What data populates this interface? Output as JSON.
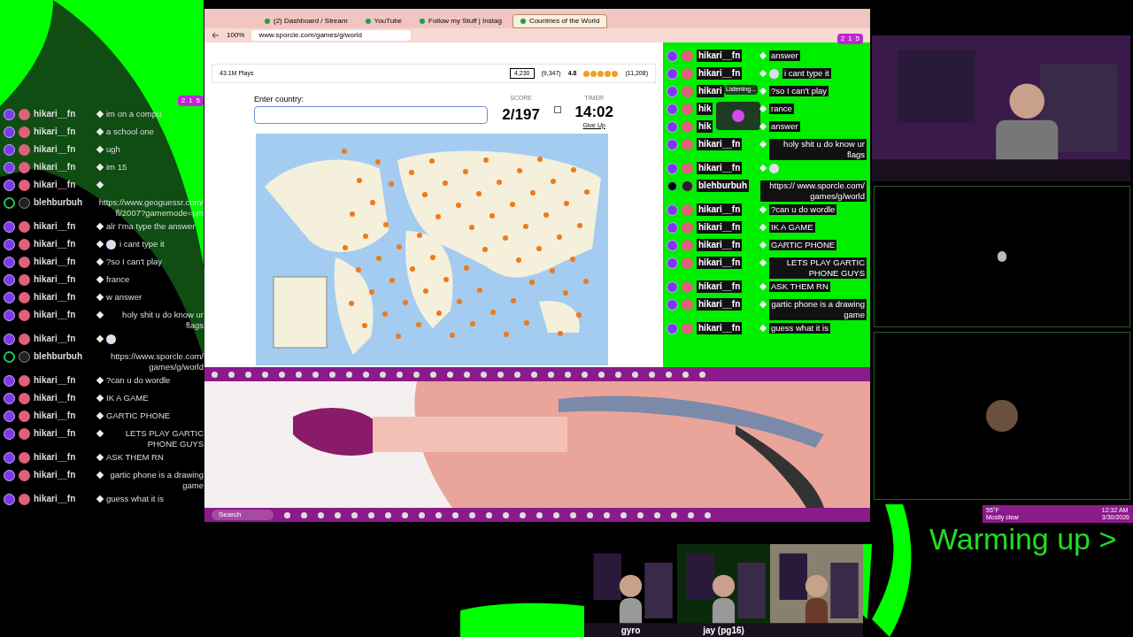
{
  "left_chat": {
    "badges": [
      "2",
      "1",
      "5"
    ],
    "messages": [
      {
        "kind": "twitch",
        "user": "hikari__fn",
        "text": "im on a compu"
      },
      {
        "kind": "twitch",
        "user": "hikari__fn",
        "text": "a school one"
      },
      {
        "kind": "twitch",
        "user": "hikari__fn",
        "text": "ugh"
      },
      {
        "kind": "twitch",
        "user": "hikari__fn",
        "text": "im 15"
      },
      {
        "kind": "twitch",
        "user": "hikari__fn"
      },
      {
        "kind": "other",
        "user": "blehburbuh",
        "text": "https://www.geoguessr.com/ fl/2007?gamemode=pin"
      },
      {
        "kind": "twitch",
        "user": "hikari__fn",
        "text": "alr I'ma type the answer"
      },
      {
        "kind": "twitch",
        "user": "hikari__fn",
        "emoji": true,
        "text": "i cant type it"
      },
      {
        "kind": "twitch",
        "user": "hikari__fn",
        "text": "?so I can't play"
      },
      {
        "kind": "twitch",
        "user": "hikari__fn",
        "text": "france"
      },
      {
        "kind": "twitch",
        "user": "hikari__fn",
        "text": "w answer"
      },
      {
        "kind": "twitch",
        "user": "hikari__fn",
        "text": "holy shit u do know ur flags"
      },
      {
        "kind": "twitch",
        "user": "hikari__fn",
        "emoji": true
      },
      {
        "kind": "other",
        "user": "blehburbuh",
        "text": "https://www.sporcle.com/ games/g/world"
      },
      {
        "kind": "twitch",
        "user": "hikari__fn",
        "text": "?can u do wordle"
      },
      {
        "kind": "twitch",
        "user": "hikari__fn",
        "text": "IK A GAME"
      },
      {
        "kind": "twitch",
        "user": "hikari__fn",
        "text": "GARTIC PHONE"
      },
      {
        "kind": "twitch",
        "user": "hikari__fn",
        "text": "LETS PLAY GARTIC PHONE GUYS"
      },
      {
        "kind": "twitch",
        "user": "hikari__fn",
        "text": "ASK THEM RN"
      },
      {
        "kind": "twitch",
        "user": "hikari__fn",
        "text": "gartic phone is a drawing game"
      },
      {
        "kind": "twitch",
        "user": "hikari__fn",
        "text": "guess what it is"
      }
    ]
  },
  "browser": {
    "tabs": [
      {
        "label": "(2) Dashboard / Stream",
        "selected": false
      },
      {
        "label": "YouTube",
        "selected": false
      },
      {
        "label": "Follow my Stuff | Instag",
        "selected": false
      },
      {
        "label": "Countries of the World",
        "selected": true
      }
    ],
    "address": "www.sporcle.com/games/g/world",
    "zoom": "100%",
    "quiz": {
      "plays": "43.1M Plays",
      "comments": "4,230",
      "likes": "(9,347)",
      "rating": "4.8",
      "stars": 5,
      "ratings": "(11,208)",
      "prompt": "Enter country:",
      "score_label": "SCORE",
      "timer_label": "TIMER",
      "score": "2/197",
      "timer": "14:02",
      "give_up": "Give Up"
    }
  },
  "right_chat": {
    "badges": [
      "2",
      "1",
      "5"
    ],
    "listening": "Listening...",
    "messages": [
      {
        "kind": "twitch",
        "user": "hikari__fn",
        "text": "answer"
      },
      {
        "kind": "twitch",
        "user": "hikari__fn",
        "emoji": true,
        "text": "i cant type it"
      },
      {
        "kind": "twitch",
        "user": "hikari",
        "text": "?so I can't play"
      },
      {
        "kind": "twitch",
        "user": "hik",
        "text": "rance"
      },
      {
        "kind": "twitch",
        "user": "hik",
        "text": "answer"
      },
      {
        "kind": "twitch",
        "user": "hikari__fn",
        "text": "holy shit u do know ur flags"
      },
      {
        "kind": "twitch",
        "user": "hikari__fn",
        "emoji": true
      },
      {
        "kind": "other",
        "user": "blehburbuh",
        "text": "https:// www.sporcle.com/ games/g/world"
      },
      {
        "kind": "twitch",
        "user": "hikari__fn",
        "text": "?can u do wordle"
      },
      {
        "kind": "twitch",
        "user": "hikari__fn",
        "text": "IK A GAME"
      },
      {
        "kind": "twitch",
        "user": "hikari__fn",
        "text": "GARTIC PHONE"
      },
      {
        "kind": "twitch",
        "user": "hikari__fn",
        "text": "LETS PLAY GARTIC PHONE GUYS"
      },
      {
        "kind": "twitch",
        "user": "hikari__fn",
        "text": "ASK THEM RN"
      },
      {
        "kind": "twitch",
        "user": "hikari__fn",
        "text": "gartic phone is a drawing game"
      },
      {
        "kind": "twitch",
        "user": "hikari__fn",
        "text": "guess what it is"
      }
    ]
  },
  "taskbar": {
    "search": "Search",
    "weather": "55°F",
    "weather_text": "Mostly clear",
    "time": "12:32 AM",
    "date": "3/30/2026"
  },
  "overlay": {
    "status": "Warming up >"
  },
  "participants": [
    {
      "name": "gyro"
    },
    {
      "name": "jay (pg16)"
    }
  ]
}
